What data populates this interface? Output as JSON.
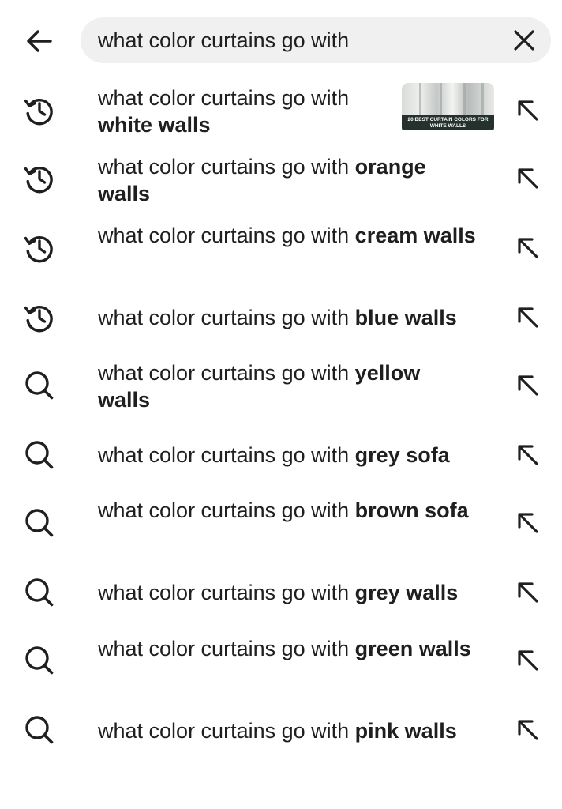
{
  "search": {
    "query": "what color curtains go with"
  },
  "icons": {
    "back": "arrow-left-icon",
    "clear": "close-icon",
    "history": "history-icon",
    "search": "search-icon",
    "fill_query": "arrow-up-left-icon"
  },
  "thumbnail": {
    "caption": "20 BEST CURTAIN COLORS FOR WHITE WALLS"
  },
  "suggestions": [
    {
      "type": "history",
      "prefix": "what color curtains go with",
      "bold": "white walls"
    },
    {
      "type": "history",
      "prefix": "what color curtains go with",
      "bold": "orange walls"
    },
    {
      "type": "history",
      "prefix": "what color curtains go with",
      "bold": "cream walls"
    },
    {
      "type": "history",
      "prefix": "what color curtains go with",
      "bold": "blue walls"
    },
    {
      "type": "search",
      "prefix": "what color curtains go with",
      "bold": "yellow walls"
    },
    {
      "type": "search",
      "prefix": "what color curtains go with",
      "bold": "grey sofa"
    },
    {
      "type": "search",
      "prefix": "what color curtains go with",
      "bold": "brown sofa"
    },
    {
      "type": "search",
      "prefix": "what color curtains go with",
      "bold": "grey walls"
    },
    {
      "type": "search",
      "prefix": "what color curtains go with",
      "bold": "green walls"
    },
    {
      "type": "search",
      "prefix": "what color curtains go with",
      "bold": "pink walls"
    }
  ]
}
